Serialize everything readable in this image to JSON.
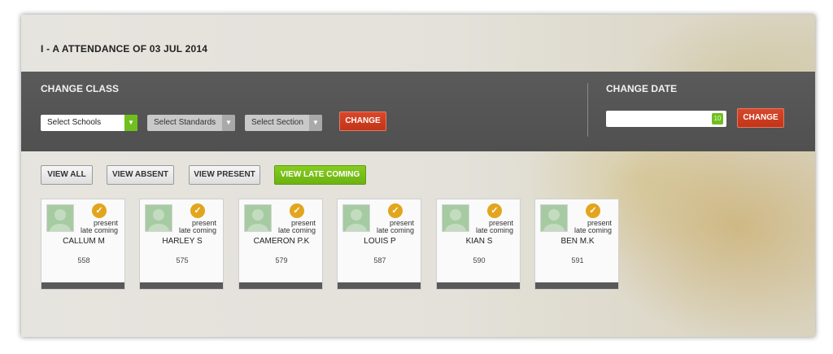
{
  "page": {
    "title": "I - A ATTENDANCE OF 03 JUL 2014"
  },
  "change_class": {
    "title": "CHANGE CLASS",
    "school_select": "Select Schools",
    "standard_select": "Select Standards",
    "section_select": "Select Section",
    "change_label": "CHANGE"
  },
  "change_date": {
    "title": "CHANGE DATE",
    "date_value": "",
    "calendar_icon_text": "10",
    "change_label": "CHANGE"
  },
  "filters": [
    {
      "label": "VIEW ALL",
      "active": false
    },
    {
      "label": "VIEW ABSENT",
      "active": false
    },
    {
      "label": "VIEW PRESENT",
      "active": false
    },
    {
      "label": "VIEW LATE COMING",
      "active": true
    }
  ],
  "students": [
    {
      "name": "CALLUM M",
      "number": "558",
      "status1": "present",
      "status2": "late coming"
    },
    {
      "name": "HARLEY S",
      "number": "575",
      "status1": "present",
      "status2": "late coming"
    },
    {
      "name": "CAMERON P.K",
      "number": "579",
      "status1": "present",
      "status2": "late coming"
    },
    {
      "name": "LOUIS P",
      "number": "587",
      "status1": "present",
      "status2": "late coming"
    },
    {
      "name": "KIAN S",
      "number": "590",
      "status1": "present",
      "status2": "late coming"
    },
    {
      "name": "BEN M.K",
      "number": "591",
      "status1": "present",
      "status2": "late coming"
    }
  ],
  "icons": {
    "check": "check-circle-icon",
    "dropdown": "chevron-down-icon",
    "calendar": "calendar-icon",
    "avatar": "avatar-placeholder-icon"
  },
  "colors": {
    "toolbar": "#555555",
    "red_button": "#c9391c",
    "green_accent": "#6fbf1e",
    "check_badge": "#e2a51d"
  }
}
